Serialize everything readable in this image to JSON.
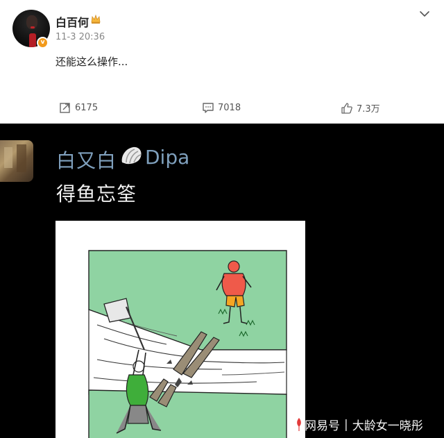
{
  "post": {
    "username": "白百何",
    "timestamp": "11-3 20:36",
    "text": "还能这么操作...",
    "badge": "v",
    "actions": {
      "repost_count": "6175",
      "comment_count": "7018",
      "like_count": "7.3万"
    }
  },
  "embedded": {
    "name": "白又白",
    "tag": "Dipa",
    "text": "得鱼忘筌"
  },
  "watermark": {
    "source": "网易号",
    "separator": "|",
    "author": "大龄女一晓彤"
  },
  "colors": {
    "verify_orange": "#f29a1b",
    "embed_name_blue": "#7fa0bd",
    "cartoon_green": "#8fd3a2",
    "shirt_red": "#ef5a4a",
    "shorts_orange": "#f5a623",
    "shirt_green": "#3fae3a"
  }
}
